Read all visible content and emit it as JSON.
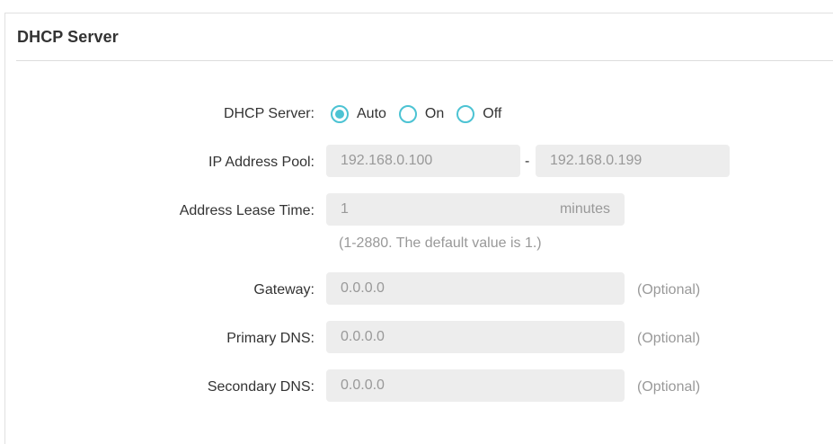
{
  "section": {
    "title": "DHCP Server"
  },
  "dhcp_server": {
    "label": "DHCP Server:",
    "options": [
      {
        "label": "Auto",
        "selected": true
      },
      {
        "label": "On",
        "selected": false
      },
      {
        "label": "Off",
        "selected": false
      }
    ],
    "accent_color": "#4cc3d3"
  },
  "ip_pool": {
    "label": "IP Address Pool:",
    "start": "192.168.0.100",
    "separator": "-",
    "end": "192.168.0.199"
  },
  "lease_time": {
    "label": "Address Lease Time:",
    "value": "1",
    "unit": "minutes",
    "hint": "(1-2880. The default value is 1.)"
  },
  "gateway": {
    "label": "Gateway:",
    "value": "0.0.0.0",
    "note": "(Optional)"
  },
  "primary_dns": {
    "label": "Primary DNS:",
    "value": "0.0.0.0",
    "note": "(Optional)"
  },
  "secondary_dns": {
    "label": "Secondary DNS:",
    "value": "0.0.0.0",
    "note": "(Optional)"
  }
}
